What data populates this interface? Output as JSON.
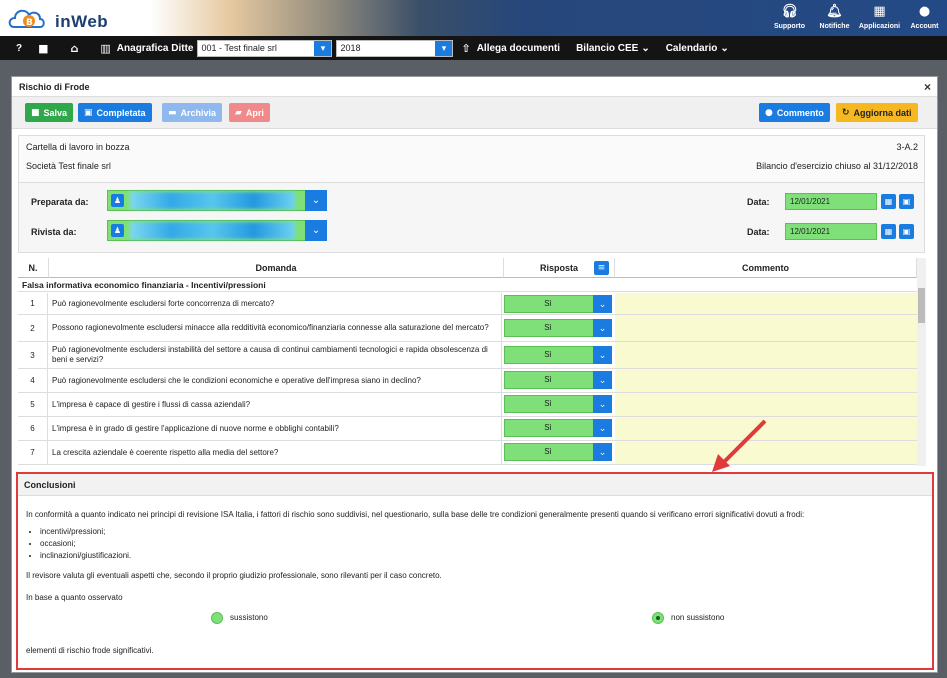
{
  "brand": {
    "name": "inWeb"
  },
  "top_icons": [
    {
      "label": "Supporto",
      "icon": "headset-icon"
    },
    {
      "label": "Notifiche",
      "icon": "bell-icon"
    },
    {
      "label": "Applicazioni",
      "icon": "grid-icon"
    },
    {
      "label": "Account",
      "icon": "user-circle-icon"
    }
  ],
  "nav": {
    "help": "?",
    "anagrafica": "Anagrafica Ditte",
    "company": "001 - Test finale srl",
    "year": "2018",
    "allega": "Allega documenti",
    "bilancio": "Bilancio CEE",
    "calendario": "Calendario"
  },
  "modal": {
    "title": "Rischio di Frode",
    "close": "×"
  },
  "toolbar": {
    "salva": "Salva",
    "completata": "Completata",
    "archivia": "Archivia",
    "apri": "Apri",
    "commento": "Commento",
    "aggiorna": "Aggiorna dati"
  },
  "info": {
    "status": "Cartella di lavoro in bozza",
    "code": "3-A.2",
    "company": "Società Test finale srl",
    "bilancio": "Bilancio d'esercizio chiuso al 31/12/2018"
  },
  "prep": {
    "preparata_label": "Preparata da:",
    "rivista_label": "Rivista da:",
    "data_label": "Data:",
    "date1": "12/01/2021",
    "date2": "12/01/2021"
  },
  "table": {
    "headers": {
      "n": "N.",
      "domanda": "Domanda",
      "risposta": "Risposta",
      "commento": "Commento"
    },
    "section": "Falsa informativa economico finanziaria - Incentivi/pressioni",
    "rows": [
      {
        "n": "1",
        "q": "Può ragionevolmente escludersi forte concorrenza di mercato?",
        "a": "Sì"
      },
      {
        "n": "2",
        "q": "Possono ragionevolmente escludersi minacce alla redditività economico/finanziaria connesse alla saturazione del mercato?",
        "a": "Sì"
      },
      {
        "n": "3",
        "q": "Può ragionevolmente escludersi instabilità del settore a causa di continui cambiamenti tecnologici e rapida obsolescenza di beni e servizi?",
        "a": "Sì"
      },
      {
        "n": "4",
        "q": "Può ragionevolmente escludersi che le condizioni economiche e operative dell'impresa siano in declino?",
        "a": "Sì"
      },
      {
        "n": "5",
        "q": "L'impresa è capace di gestire i flussi di cassa aziendali?",
        "a": "Sì"
      },
      {
        "n": "6",
        "q": "L'impresa è in grado di gestire l'applicazione di nuove norme e obblighi contabili?",
        "a": "Sì"
      },
      {
        "n": "7",
        "q": "La crescita aziendale è coerente rispetto alla media del settore?",
        "a": "Sì"
      }
    ]
  },
  "conclusioni": {
    "title": "Conclusioni",
    "intro": "In conformità a quanto indicato nei principi di revisione ISA Italia, i fattori di rischio sono suddivisi, nel questionario, sulla base delle tre condizioni generalmente presenti quando si verificano errori significativi dovuti a frodi:",
    "bullets": [
      "incentivi/pressioni;",
      "occasioni;",
      "inclinazioni/giustificazioni."
    ],
    "p2": "Il revisore valuta gli eventuali aspetti che, secondo il proprio giudizio professionale, sono rilevanti per il caso concreto.",
    "p3": "In base a quanto osservato",
    "opt1": "sussistono",
    "opt2": "non sussistono",
    "selected": "non sussistono",
    "p4": "elementi di rischio frode significativi."
  }
}
